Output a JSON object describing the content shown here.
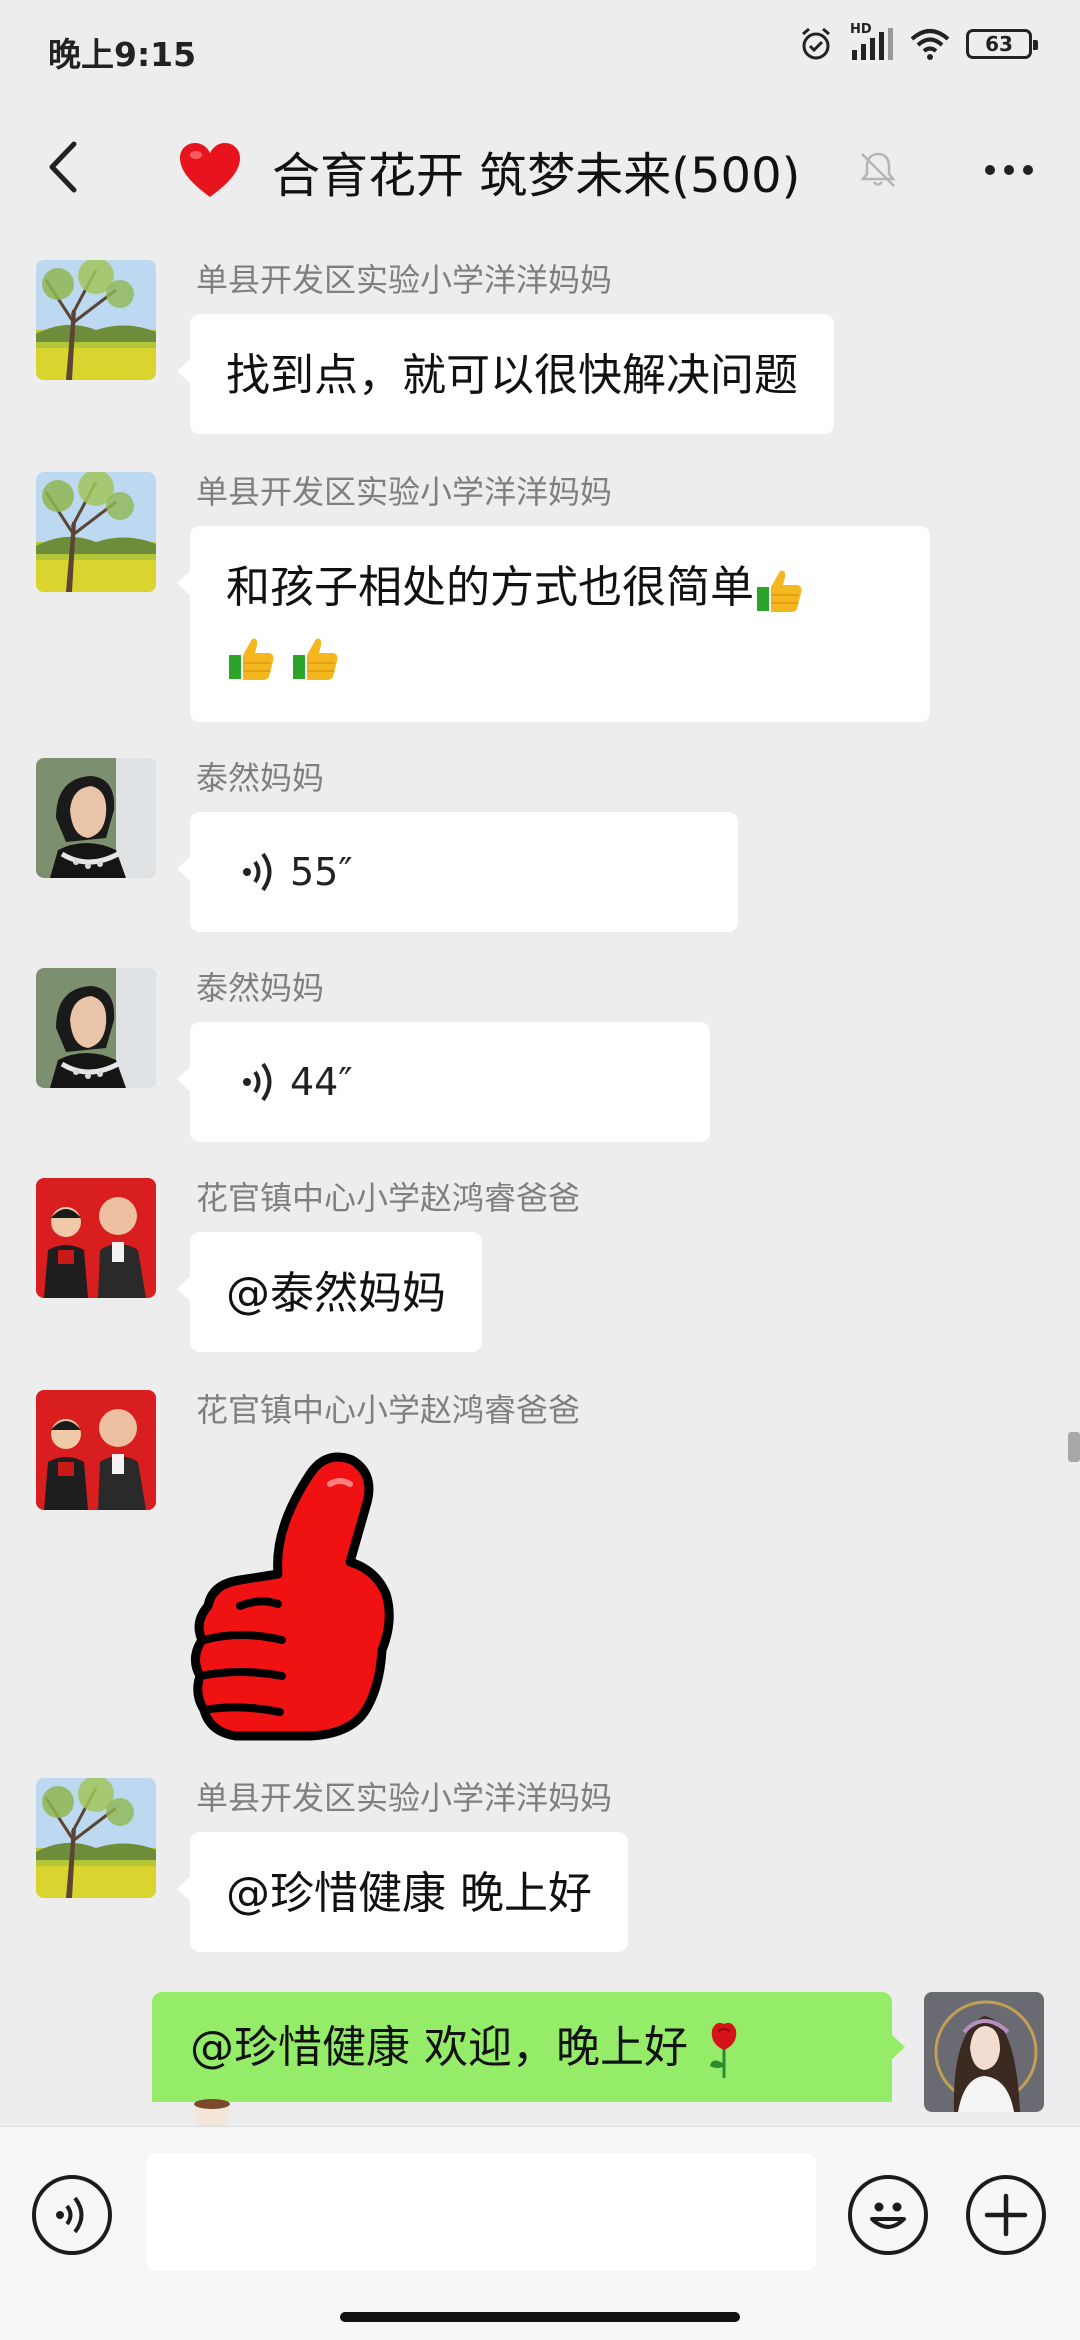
{
  "status": {
    "time": "晚上9:15",
    "network": "HD",
    "battery": "63"
  },
  "header": {
    "title": "合育花开 筑梦未来(500)",
    "title_emoji": "heart",
    "muted": true
  },
  "messages": [
    {
      "sender": "单县开发区实验小学洋洋妈妈",
      "type": "text",
      "text": "找到点，就可以很快解决问题",
      "avatar": "landscape"
    },
    {
      "sender": "单县开发区实验小学洋洋妈妈",
      "type": "text",
      "line1": "和孩子相处的方式也很简单",
      "emoji": "thumbs-up",
      "emoji_count": 3,
      "avatar": "landscape"
    },
    {
      "sender": "泰然妈妈",
      "type": "voice",
      "duration": "55″",
      "avatar": "portrait-woman"
    },
    {
      "sender": "泰然妈妈",
      "type": "voice",
      "duration": "44″",
      "avatar": "portrait-woman"
    },
    {
      "sender": "花官镇中心小学赵鸿睿爸爸",
      "type": "text",
      "text": "@泰然妈妈",
      "avatar": "father-son"
    },
    {
      "sender": "花官镇中心小学赵鸿睿爸爸",
      "type": "sticker",
      "sticker": "red-thumbs-up",
      "avatar": "father-son"
    },
    {
      "sender": "单县开发区实验小学洋洋妈妈",
      "type": "text",
      "text": "@珍惜健康  晚上好",
      "avatar": "landscape"
    }
  ],
  "self_message": {
    "text": "@珍惜健康  欢迎，晚上好",
    "emoji": "rose",
    "avatar": "illustrated-girl"
  },
  "input": {
    "placeholder": "",
    "value": ""
  },
  "colors": {
    "background": "#ededed",
    "bubble_other": "#ffffff",
    "bubble_self": "#95ec69",
    "sender_name": "#7f7f7f"
  },
  "icons": [
    "back-icon",
    "heart-icon",
    "mute-icon",
    "more-icon",
    "voice-wave-icon",
    "emoji-icon",
    "plus-icon"
  ]
}
